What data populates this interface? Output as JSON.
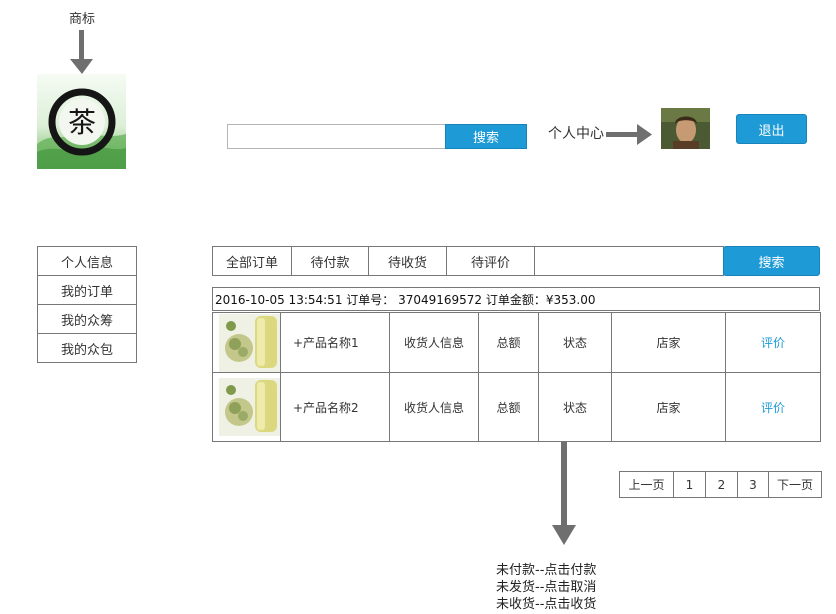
{
  "header": {
    "logo_caption": "商标",
    "logo_glyph": "茶",
    "search": {
      "value": "",
      "button_label": "搜索"
    },
    "user_center_label": "个人中心",
    "logout_label": "退出"
  },
  "sidebar": {
    "items": [
      {
        "label": "个人信息"
      },
      {
        "label": "我的订单"
      },
      {
        "label": "我的众筹"
      },
      {
        "label": "我的众包"
      }
    ]
  },
  "order_tabs": {
    "tabs": [
      {
        "label": "全部订单"
      },
      {
        "label": "待付款"
      },
      {
        "label": "待收货"
      },
      {
        "label": "待评价"
      }
    ],
    "search_value": "",
    "search_button": "搜索"
  },
  "order": {
    "info": "2016-10-05 13:54:51 订单号： 37049169572 订单金额：¥353.00",
    "rows": [
      {
        "product": "+产品名称1",
        "receiver": "收货人信息",
        "total": "总额",
        "status": "状态",
        "shop": "店家",
        "action": "评价"
      },
      {
        "product": "+产品名称2",
        "receiver": "收货人信息",
        "total": "总额",
        "status": "状态",
        "shop": "店家",
        "action": "评价"
      }
    ]
  },
  "pagination": {
    "prev": "上一页",
    "pages": [
      "1",
      "2",
      "3"
    ],
    "next": "下一页"
  },
  "status_notes": [
    "未付款--点击付款",
    "未发货--点击取消",
    "未收货--点击收货"
  ],
  "colors": {
    "accent": "#1e9ad6",
    "border": "#777777",
    "arrow": "#6f6f6f"
  }
}
